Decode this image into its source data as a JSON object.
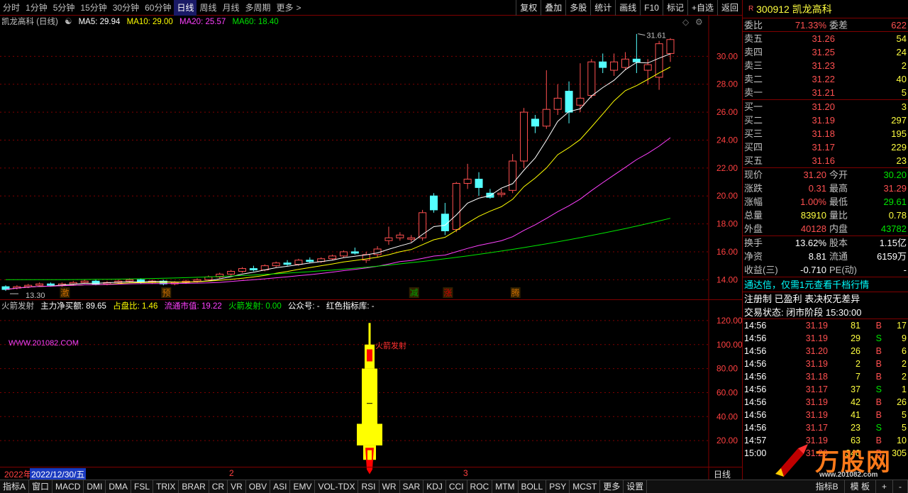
{
  "toolbar": {
    "periods": [
      "分时",
      "1分钟",
      "5分钟",
      "15分钟",
      "30分钟",
      "60分钟",
      "日线",
      "周线",
      "月线",
      "多周期",
      "更多"
    ],
    "active_period": "日线",
    "more_arrow": ">",
    "tools": [
      "复权",
      "叠加",
      "多股",
      "统计",
      "画线",
      "F10",
      "标记",
      "+自选",
      "返回"
    ]
  },
  "main_legend": {
    "name": "凯龙高科 (日线)",
    "ma5": "MA5: 29.94",
    "ma10": "MA10: 29.00",
    "ma20": "MA20: 25.57",
    "ma60": "MA60: 18.40"
  },
  "annotations": {
    "high_label": "31.61",
    "low_label": "13.30",
    "signals": [
      "激",
      "预",
      "减",
      "涨",
      "腾"
    ]
  },
  "sub_legend": {
    "name": "火箭发射",
    "net_buy": "主力净买额: 89.65",
    "ratio": "占盘比: 1.46",
    "float_cap": "流通市值: 19.22",
    "rocket": "火箭发射: 0.00",
    "wechat": "公众号: -",
    "library": "红色指标库: -",
    "watermark": "WWW.201082.COM",
    "rocket_label": "火箭发射"
  },
  "colors": {
    "up": "#ff5050",
    "down": "#54ffff",
    "ma5": "#ffffff",
    "ma10": "#ffff00",
    "ma20": "#ff40ff",
    "ma60": "#00e600",
    "grid": "#800000"
  },
  "chart_data": {
    "type": "candlestick",
    "price_axis": [
      "30.00",
      "28.00",
      "26.00",
      "24.00",
      "22.00",
      "20.00",
      "18.00",
      "16.00",
      "14.00"
    ],
    "price_range": [
      13.0,
      32.0
    ],
    "sub_axis": [
      "120.00",
      "100.00",
      "80.00",
      "60.00",
      "40.00",
      "20.00"
    ],
    "sub_range": [
      0,
      130
    ],
    "candles": [
      [
        13.5,
        13.6,
        13.2,
        13.3
      ],
      [
        13.4,
        13.6,
        13.3,
        13.5
      ],
      [
        13.5,
        13.7,
        13.4,
        13.6
      ],
      [
        13.6,
        13.8,
        13.5,
        13.7
      ],
      [
        13.7,
        13.8,
        13.5,
        13.6
      ],
      [
        13.6,
        13.8,
        13.5,
        13.7
      ],
      [
        13.7,
        13.9,
        13.6,
        13.8
      ],
      [
        13.8,
        14.0,
        13.7,
        13.9
      ],
      [
        13.9,
        14.0,
        13.6,
        13.7
      ],
      [
        13.7,
        13.9,
        13.6,
        13.8
      ],
      [
        13.8,
        14.0,
        13.7,
        13.9
      ],
      [
        13.9,
        14.1,
        13.8,
        14.0
      ],
      [
        14.0,
        14.1,
        13.7,
        13.8
      ],
      [
        13.8,
        14.0,
        13.7,
        13.9
      ],
      [
        13.9,
        14.0,
        13.6,
        13.7
      ],
      [
        13.7,
        13.9,
        13.6,
        13.8
      ],
      [
        13.8,
        14.0,
        13.7,
        13.9
      ],
      [
        13.9,
        14.1,
        13.8,
        14.0
      ],
      [
        14.0,
        14.3,
        13.9,
        14.2
      ],
      [
        14.2,
        14.5,
        14.1,
        14.4
      ],
      [
        14.4,
        14.7,
        14.3,
        14.6
      ],
      [
        14.6,
        14.9,
        14.5,
        14.8
      ],
      [
        14.8,
        15.0,
        14.6,
        14.7
      ],
      [
        14.7,
        15.1,
        14.6,
        15.0
      ],
      [
        15.0,
        15.3,
        14.9,
        15.2
      ],
      [
        15.2,
        15.4,
        15.0,
        15.1
      ],
      [
        15.1,
        15.5,
        15.0,
        15.4
      ],
      [
        15.4,
        15.6,
        15.2,
        15.3
      ],
      [
        15.3,
        15.6,
        15.2,
        15.5
      ],
      [
        15.5,
        15.8,
        15.4,
        15.7
      ],
      [
        15.7,
        16.1,
        15.6,
        16.0
      ],
      [
        16.0,
        16.3,
        15.8,
        15.9
      ],
      [
        15.4,
        16.0,
        15.2,
        15.8
      ],
      [
        15.8,
        16.4,
        15.6,
        16.2
      ],
      [
        16.8,
        17.8,
        16.5,
        17.0
      ],
      [
        17.0,
        17.4,
        16.8,
        17.2
      ],
      [
        16.9,
        17.2,
        16.7,
        17.0
      ],
      [
        17.0,
        19.0,
        16.8,
        18.8
      ],
      [
        20.0,
        20.2,
        18.8,
        19.0
      ],
      [
        18.7,
        19.5,
        17.2,
        17.5
      ],
      [
        17.6,
        21.0,
        17.4,
        20.9
      ],
      [
        20.9,
        22.3,
        20.5,
        21.2
      ],
      [
        21.2,
        21.7,
        20.0,
        20.6
      ],
      [
        20.2,
        20.5,
        19.8,
        19.9
      ],
      [
        20.1,
        20.5,
        19.9,
        20.2
      ],
      [
        20.4,
        23.0,
        20.2,
        22.5
      ],
      [
        22.5,
        26.3,
        22.0,
        26.0
      ],
      [
        25.5,
        25.8,
        24.5,
        25.0
      ],
      [
        25.0,
        29.0,
        24.8,
        26.2
      ],
      [
        26.2,
        28.0,
        25.8,
        27.0
      ],
      [
        27.5,
        28.2,
        25.2,
        26.0
      ],
      [
        26.5,
        29.5,
        26.0,
        27.0
      ],
      [
        27.2,
        29.8,
        27.0,
        29.6
      ],
      [
        29.6,
        30.2,
        28.8,
        29.2
      ],
      [
        29.0,
        30.2,
        28.6,
        29.6
      ],
      [
        29.2,
        30.3,
        29.0,
        29.8
      ],
      [
        29.8,
        31.6,
        28.8,
        29.6
      ],
      [
        29.0,
        29.8,
        28.0,
        29.4
      ],
      [
        28.5,
        31.1,
        27.6,
        30.9
      ],
      [
        30.2,
        31.3,
        29.6,
        31.2
      ]
    ]
  },
  "time_axis": {
    "year_label": "2022年",
    "cursor_date": "2022/12/30/五",
    "marks": [
      "2",
      "3"
    ],
    "period_label": "日线"
  },
  "bottom_tabs": [
    "指标A",
    "窗口",
    "MACD",
    "DMI",
    "DMA",
    "FSL",
    "TRIX",
    "BRAR",
    "CR",
    "VR",
    "OBV",
    "ASI",
    "EMV",
    "VOL-TDX",
    "RSI",
    "WR",
    "SAR",
    "KDJ",
    "CCI",
    "ROC",
    "MTM",
    "BOLL",
    "PSY",
    "MCST",
    "更多",
    "设置"
  ],
  "bottom_right_tabs": [
    "指标B",
    "模 板",
    "+",
    "-"
  ],
  "side": {
    "code": "300912",
    "name": "凯龙高科",
    "r_badge": "R",
    "weibi_label": "委比",
    "weibi": "71.33%",
    "weicha_label": "委差",
    "weicha": "622",
    "asks": [
      {
        "label": "卖五",
        "price": "31.26",
        "vol": "54"
      },
      {
        "label": "卖四",
        "price": "31.25",
        "vol": "24"
      },
      {
        "label": "卖三",
        "price": "31.23",
        "vol": "2"
      },
      {
        "label": "卖二",
        "price": "31.22",
        "vol": "40"
      },
      {
        "label": "卖一",
        "price": "31.21",
        "vol": "5"
      }
    ],
    "bids": [
      {
        "label": "买一",
        "price": "31.20",
        "vol": "3"
      },
      {
        "label": "买二",
        "price": "31.19",
        "vol": "297"
      },
      {
        "label": "买三",
        "price": "31.18",
        "vol": "195"
      },
      {
        "label": "买四",
        "price": "31.17",
        "vol": "229"
      },
      {
        "label": "买五",
        "price": "31.16",
        "vol": "23"
      }
    ],
    "quote": [
      {
        "l1": "现价",
        "v1": "31.20",
        "c1": "red",
        "l2": "今开",
        "v2": "30.20",
        "c2": "green"
      },
      {
        "l1": "涨跌",
        "v1": "0.31",
        "c1": "red",
        "l2": "最高",
        "v2": "31.29",
        "c2": "red"
      },
      {
        "l1": "涨幅",
        "v1": "1.00%",
        "c1": "red",
        "l2": "最低",
        "v2": "29.61",
        "c2": "green"
      },
      {
        "l1": "总量",
        "v1": "83910",
        "c1": "yel",
        "l2": "量比",
        "v2": "0.78",
        "c2": "yel"
      },
      {
        "l1": "外盘",
        "v1": "40128",
        "c1": "red",
        "l2": "内盘",
        "v2": "43782",
        "c2": "green"
      }
    ],
    "fin": [
      {
        "l1": "换手",
        "v1": "13.62%",
        "l2": "股本",
        "v2": "1.15亿"
      },
      {
        "l1": "净资",
        "v1": "8.81",
        "l2": "流通",
        "v2": "6159万"
      },
      {
        "l1": "收益(三)",
        "v1": "-0.710",
        "l2": "PE(动)",
        "v2": "-"
      }
    ],
    "promo": "通达信，仅需1元查看千档行情",
    "promo2": "注册制 已盈利 表决权无差异",
    "status": "交易状态: 闭市阶段 15:30:00",
    "ticks": [
      {
        "t": "14:56",
        "p": "31.19",
        "v": "81",
        "bs": "B",
        "n": "17"
      },
      {
        "t": "14:56",
        "p": "31.19",
        "v": "29",
        "bs": "S",
        "n": "9"
      },
      {
        "t": "14:56",
        "p": "31.20",
        "v": "26",
        "bs": "B",
        "n": "6"
      },
      {
        "t": "14:56",
        "p": "31.19",
        "v": "2",
        "bs": "B",
        "n": "2"
      },
      {
        "t": "14:56",
        "p": "31.18",
        "v": "7",
        "bs": "B",
        "n": "2"
      },
      {
        "t": "14:56",
        "p": "31.17",
        "v": "37",
        "bs": "S",
        "n": "1"
      },
      {
        "t": "14:56",
        "p": "31.19",
        "v": "42",
        "bs": "B",
        "n": "26"
      },
      {
        "t": "14:56",
        "p": "31.19",
        "v": "41",
        "bs": "B",
        "n": "5"
      },
      {
        "t": "14:56",
        "p": "31.17",
        "v": "23",
        "bs": "S",
        "n": "5"
      },
      {
        "t": "14:57",
        "p": "31.19",
        "v": "63",
        "bs": "B",
        "n": "10"
      },
      {
        "t": "15:00",
        "p": "31.20",
        "v": "340",
        "bs": "B",
        "n": "305"
      }
    ],
    "logo_text": "万股网",
    "logo_url": "www.201082.com"
  }
}
